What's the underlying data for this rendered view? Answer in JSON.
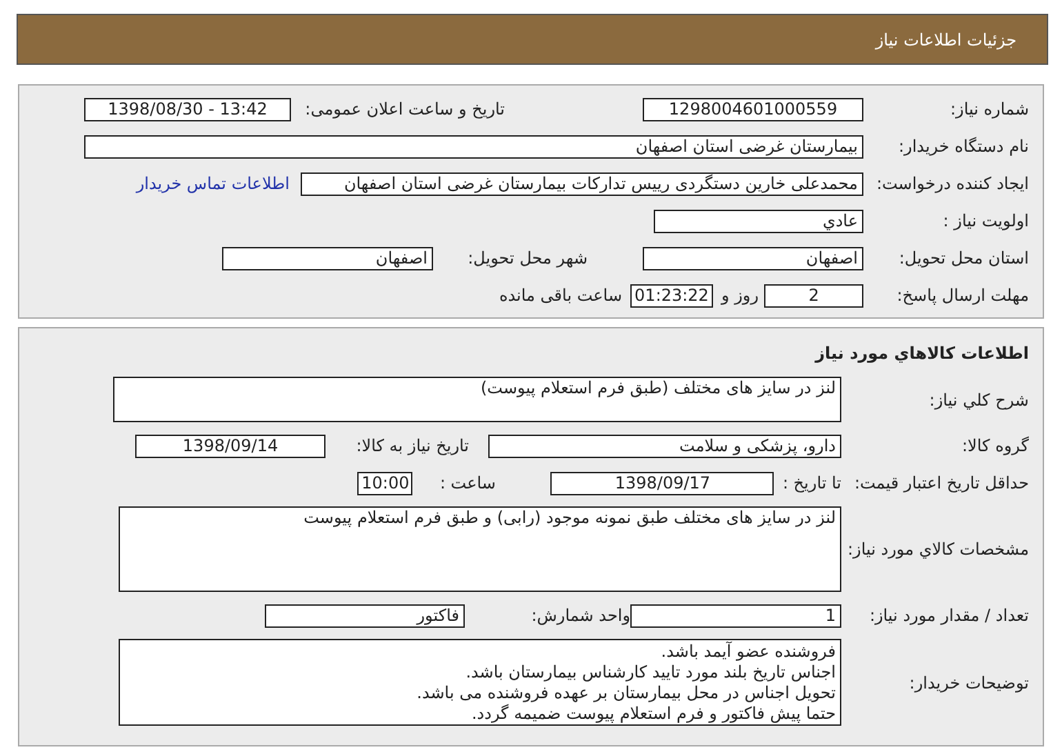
{
  "header": {
    "title": "جزئیات اطلاعات نیاز"
  },
  "need": {
    "need_number": {
      "label": "شماره نیاز:",
      "value": "1298004601000559"
    },
    "announce": {
      "label": "تاریخ و ساعت اعلان عمومی:",
      "value": "1398/08/30 - 13:42"
    },
    "buyer": {
      "label": "نام دستگاه خریدار:",
      "value": "بیمارستان غرضی استان اصفهان"
    },
    "creator": {
      "label": "ایجاد کننده درخواست:",
      "value": "محمدعلی خارین دستگردی رییس تدارکات بیمارستان غرضی استان اصفهان",
      "link": "اطلاعات تماس خریدار"
    },
    "priority": {
      "label": "اولویت نیاز :",
      "value": "عادي"
    },
    "province": {
      "label": "استان محل تحویل:",
      "value": "اصفهان"
    },
    "city": {
      "label": "شهر محل تحویل:",
      "value": "اصفهان"
    },
    "deadline": {
      "label": "مهلت ارسال پاسخ:",
      "days": "2",
      "days_text": "روز و",
      "time": "01:23:22",
      "time_text": "ساعت باقی مانده"
    }
  },
  "goods": {
    "title": "اطلاعات کالاهاي مورد نیاز",
    "summary": {
      "label": "شرح کلي نیاز:",
      "value": "لنز در سایز های مختلف (طبق فرم استعلام پیوست)"
    },
    "group": {
      "label": "گروه کالا:",
      "value": "دارو، پزشکی و سلامت"
    },
    "need_date": {
      "label": "تاریخ نیاز به کالا:",
      "value": "1398/09/14"
    },
    "validity": {
      "label": "حداقل تاریخ اعتبار قیمت:",
      "date_label": "تا تاریخ :",
      "date": "1398/09/17",
      "time_label": "ساعت :",
      "time": "10:00"
    },
    "specs": {
      "label": "مشخصات کالاي مورد نیاز:",
      "value": "لنز در سایز های مختلف طبق نمونه موجود (رابی) و طبق فرم استعلام پیوست"
    },
    "quantity": {
      "label": "تعداد / مقدار مورد نیاز:",
      "value": "1"
    },
    "unit": {
      "label": "واحد شمارش:",
      "value": "فاکتور"
    },
    "notes": {
      "label": "توضیحات خریدار:",
      "lines": [
        "فروشنده عضو آیمد باشد.",
        "اجناس تاریخ بلند مورد تایید کارشناس بیمارستان باشد.",
        "تحویل اجناس در محل بیمارستان بر عهده فروشنده می باشد.",
        "حتما پیش فاکتور  و فرم استعلام پیوست ضمیمه گردد."
      ]
    }
  }
}
